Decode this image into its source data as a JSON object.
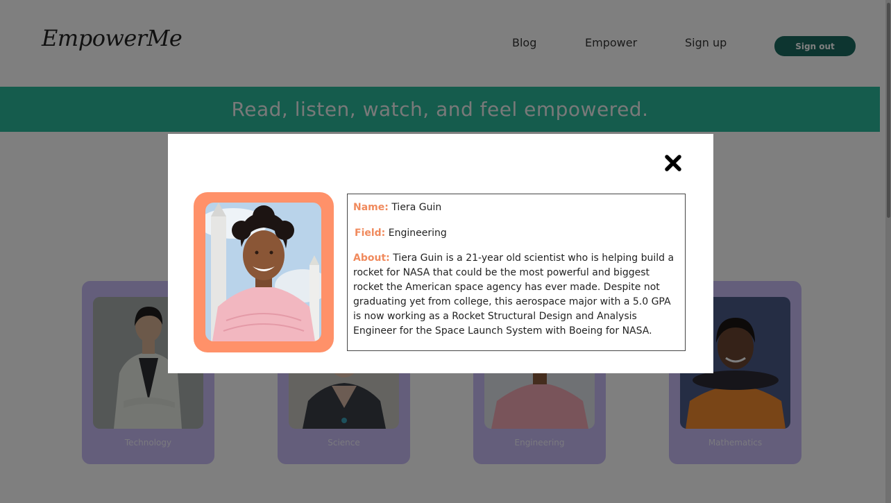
{
  "header": {
    "logo": "EmpowerMe",
    "nav": [
      {
        "label": "Blog"
      },
      {
        "label": "Empower"
      },
      {
        "label": "Sign up"
      }
    ],
    "signout_label": "Sign out"
  },
  "banner": {
    "text": "Read, listen, watch, and feel empowered."
  },
  "cards": [
    {
      "label": "Technology"
    },
    {
      "label": "Science"
    },
    {
      "label": "Engineering"
    },
    {
      "label": "Mathematics"
    }
  ],
  "modal": {
    "close_icon": "close-icon",
    "name_key": "Name:",
    "name_value": "Tiera Guin",
    "field_key": "Field:",
    "field_value": "Engineering",
    "about_key": "About:",
    "about_value": "Tiera Guin is a 21-year old scientist who is helping build a rocket for NASA that could be the most powerful and biggest rocket the American space agency has ever made. Despite not graduating yet from college, this aerospace major with a 5.0 GPA is now working as a Rocket Structural Design and Analysis Engineer for the Space Launch System with Boeing for NASA."
  },
  "colors": {
    "brand_green": "#2bb89a",
    "button_green": "#1b6b60",
    "card_purple": "#c8bdf6",
    "accent_orange": "#ff9169",
    "key_orange": "#f08a5d"
  }
}
